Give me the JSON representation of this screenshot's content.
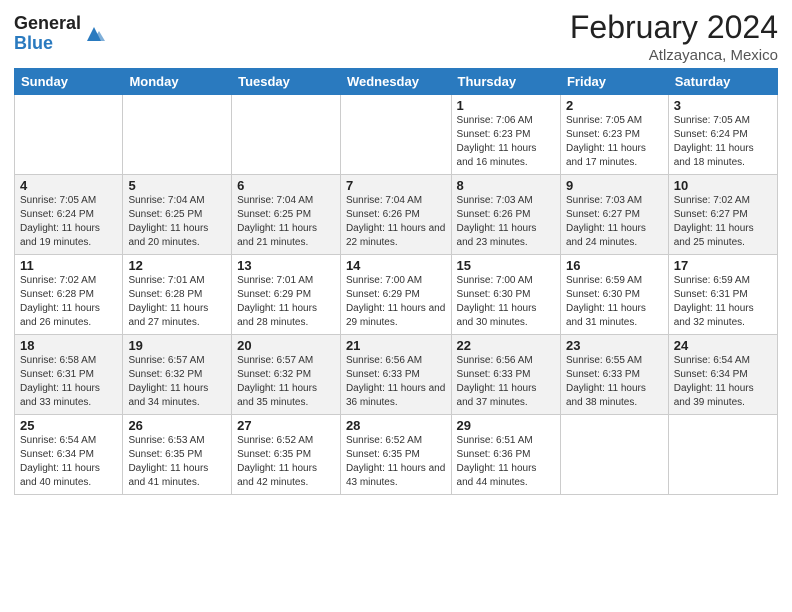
{
  "header": {
    "logo_general": "General",
    "logo_blue": "Blue",
    "main_title": "February 2024",
    "subtitle": "Atlzayanca, Mexico"
  },
  "weekdays": [
    "Sunday",
    "Monday",
    "Tuesday",
    "Wednesday",
    "Thursday",
    "Friday",
    "Saturday"
  ],
  "weeks": [
    [
      {
        "day": "",
        "info": ""
      },
      {
        "day": "",
        "info": ""
      },
      {
        "day": "",
        "info": ""
      },
      {
        "day": "",
        "info": ""
      },
      {
        "day": "1",
        "info": "Sunrise: 7:06 AM\nSunset: 6:23 PM\nDaylight: 11 hours and 16 minutes."
      },
      {
        "day": "2",
        "info": "Sunrise: 7:05 AM\nSunset: 6:23 PM\nDaylight: 11 hours and 17 minutes."
      },
      {
        "day": "3",
        "info": "Sunrise: 7:05 AM\nSunset: 6:24 PM\nDaylight: 11 hours and 18 minutes."
      }
    ],
    [
      {
        "day": "4",
        "info": "Sunrise: 7:05 AM\nSunset: 6:24 PM\nDaylight: 11 hours and 19 minutes."
      },
      {
        "day": "5",
        "info": "Sunrise: 7:04 AM\nSunset: 6:25 PM\nDaylight: 11 hours and 20 minutes."
      },
      {
        "day": "6",
        "info": "Sunrise: 7:04 AM\nSunset: 6:25 PM\nDaylight: 11 hours and 21 minutes."
      },
      {
        "day": "7",
        "info": "Sunrise: 7:04 AM\nSunset: 6:26 PM\nDaylight: 11 hours and 22 minutes."
      },
      {
        "day": "8",
        "info": "Sunrise: 7:03 AM\nSunset: 6:26 PM\nDaylight: 11 hours and 23 minutes."
      },
      {
        "day": "9",
        "info": "Sunrise: 7:03 AM\nSunset: 6:27 PM\nDaylight: 11 hours and 24 minutes."
      },
      {
        "day": "10",
        "info": "Sunrise: 7:02 AM\nSunset: 6:27 PM\nDaylight: 11 hours and 25 minutes."
      }
    ],
    [
      {
        "day": "11",
        "info": "Sunrise: 7:02 AM\nSunset: 6:28 PM\nDaylight: 11 hours and 26 minutes."
      },
      {
        "day": "12",
        "info": "Sunrise: 7:01 AM\nSunset: 6:28 PM\nDaylight: 11 hours and 27 minutes."
      },
      {
        "day": "13",
        "info": "Sunrise: 7:01 AM\nSunset: 6:29 PM\nDaylight: 11 hours and 28 minutes."
      },
      {
        "day": "14",
        "info": "Sunrise: 7:00 AM\nSunset: 6:29 PM\nDaylight: 11 hours and 29 minutes."
      },
      {
        "day": "15",
        "info": "Sunrise: 7:00 AM\nSunset: 6:30 PM\nDaylight: 11 hours and 30 minutes."
      },
      {
        "day": "16",
        "info": "Sunrise: 6:59 AM\nSunset: 6:30 PM\nDaylight: 11 hours and 31 minutes."
      },
      {
        "day": "17",
        "info": "Sunrise: 6:59 AM\nSunset: 6:31 PM\nDaylight: 11 hours and 32 minutes."
      }
    ],
    [
      {
        "day": "18",
        "info": "Sunrise: 6:58 AM\nSunset: 6:31 PM\nDaylight: 11 hours and 33 minutes."
      },
      {
        "day": "19",
        "info": "Sunrise: 6:57 AM\nSunset: 6:32 PM\nDaylight: 11 hours and 34 minutes."
      },
      {
        "day": "20",
        "info": "Sunrise: 6:57 AM\nSunset: 6:32 PM\nDaylight: 11 hours and 35 minutes."
      },
      {
        "day": "21",
        "info": "Sunrise: 6:56 AM\nSunset: 6:33 PM\nDaylight: 11 hours and 36 minutes."
      },
      {
        "day": "22",
        "info": "Sunrise: 6:56 AM\nSunset: 6:33 PM\nDaylight: 11 hours and 37 minutes."
      },
      {
        "day": "23",
        "info": "Sunrise: 6:55 AM\nSunset: 6:33 PM\nDaylight: 11 hours and 38 minutes."
      },
      {
        "day": "24",
        "info": "Sunrise: 6:54 AM\nSunset: 6:34 PM\nDaylight: 11 hours and 39 minutes."
      }
    ],
    [
      {
        "day": "25",
        "info": "Sunrise: 6:54 AM\nSunset: 6:34 PM\nDaylight: 11 hours and 40 minutes."
      },
      {
        "day": "26",
        "info": "Sunrise: 6:53 AM\nSunset: 6:35 PM\nDaylight: 11 hours and 41 minutes."
      },
      {
        "day": "27",
        "info": "Sunrise: 6:52 AM\nSunset: 6:35 PM\nDaylight: 11 hours and 42 minutes."
      },
      {
        "day": "28",
        "info": "Sunrise: 6:52 AM\nSunset: 6:35 PM\nDaylight: 11 hours and 43 minutes."
      },
      {
        "day": "29",
        "info": "Sunrise: 6:51 AM\nSunset: 6:36 PM\nDaylight: 11 hours and 44 minutes."
      },
      {
        "day": "",
        "info": ""
      },
      {
        "day": "",
        "info": ""
      }
    ]
  ]
}
